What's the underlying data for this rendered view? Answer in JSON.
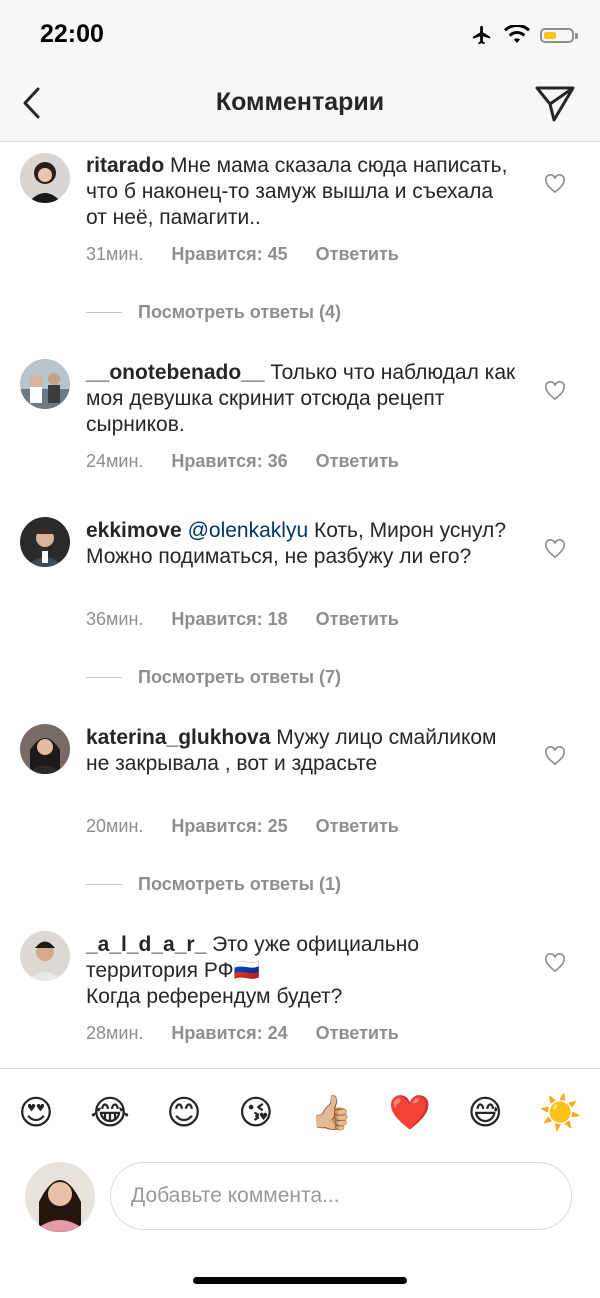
{
  "status_bar": {
    "time": "22:00"
  },
  "header": {
    "title": "Комментарии"
  },
  "comments": [
    {
      "username": "ritarado",
      "mention": "",
      "text": "Мне мама сказала сюда написать, что б наконец-то замуж вышла и съехала от неё, памагити..",
      "time": "31мин.",
      "likes": "Нравится: 45",
      "reply": "Ответить",
      "view_replies": "Посмотреть ответы (4)"
    },
    {
      "username": "__onotebenado__",
      "mention": "",
      "text": "Только что наблюдал как моя девушка скринит отсюда рецепт сырников.",
      "time": "24мин.",
      "likes": "Нравится: 36",
      "reply": "Ответить",
      "view_replies": ""
    },
    {
      "username": "ekkimove",
      "mention": "@olenkaklyu",
      "text": "Коть, Мирон уснул? Можно подиматься, не разбужу ли его?",
      "time": "36мин.",
      "likes": "Нравится: 18",
      "reply": "Ответить",
      "view_replies": "Посмотреть ответы (7)"
    },
    {
      "username": "katerina_glukhova",
      "mention": "",
      "text": "Мужу лицо смайликом не закрывала , вот и здрасьте",
      "time": "20мин.",
      "likes": "Нравится: 25",
      "reply": "Ответить",
      "view_replies": "Посмотреть ответы (1)"
    },
    {
      "username": "_a_l_d_a_r_",
      "mention": "",
      "text": "Это уже официально территория РФ🇷🇺",
      "text2": "Когда референдум будет?",
      "time": "28мин.",
      "likes": "Нравится: 24",
      "reply": "Ответить",
      "view_replies": ""
    }
  ],
  "emoji_bar": [
    "😍",
    "😂",
    "😊",
    "😘",
    "👍🏼",
    "❤️",
    "😅",
    "☀️"
  ],
  "composer": {
    "placeholder": "Добавьте коммента..."
  },
  "colors": {
    "text": "#262626",
    "secondary": "#8e8e8e",
    "mention": "#003569",
    "battery": "#f5c518"
  }
}
